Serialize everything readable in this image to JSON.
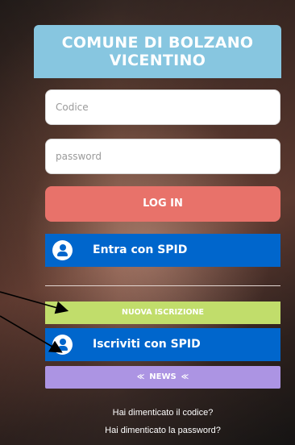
{
  "header": {
    "line1": "COMUNE DI BOLZANO",
    "line2": "VICENTINO"
  },
  "form": {
    "codice_placeholder": "Codice",
    "password_placeholder": "password",
    "login_label": "LOG IN"
  },
  "spid": {
    "enter_label": "Entra con SPID",
    "register_label": "Iscriviti con SPID",
    "icon": "user-circle-icon"
  },
  "nuova_iscrizione_label": "NUOVA ISCRIZIONE",
  "news": {
    "label": "NEWS",
    "chevron": "»"
  },
  "links": {
    "forgot_code": "Hai dimenticato il codice?",
    "forgot_password": "Hai dimenticato la password?"
  },
  "colors": {
    "header": "#87c6e0",
    "login": "#e8726a",
    "spid": "#0066cc",
    "nuova": "#c1dd6b",
    "news": "#ac94e3"
  }
}
